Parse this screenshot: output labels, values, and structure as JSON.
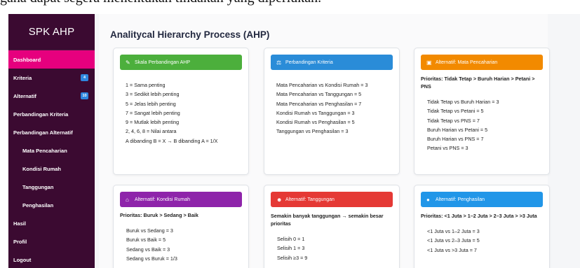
{
  "caption": "gana dapat segera menentukan tindakan yang diperlukan.",
  "brand": "SPK AHP",
  "sidebar": {
    "items": [
      {
        "label": "Dashboard",
        "badge": ""
      },
      {
        "label": "Kriteria",
        "badge": "4"
      },
      {
        "label": "Alternatif",
        "badge": "10"
      },
      {
        "label": "Perbandingan Kriteria",
        "badge": ""
      },
      {
        "label": "Perbandingan Alternatif",
        "badge": ""
      },
      {
        "label": "Mata Pencaharian",
        "badge": ""
      },
      {
        "label": "Kondisi Rumah",
        "badge": ""
      },
      {
        "label": "Tanggungan",
        "badge": ""
      },
      {
        "label": "Penghasilan",
        "badge": ""
      },
      {
        "label": "Hasil",
        "badge": ""
      },
      {
        "label": "Profil",
        "badge": ""
      },
      {
        "label": "Logout",
        "badge": ""
      }
    ]
  },
  "main": {
    "title": "Analitycal Hierarchy Process (AHP)",
    "cards": [
      {
        "title": "Skala Perbandingan AHP",
        "icon": "pencil-icon",
        "color": "#4caf3c",
        "priority": "",
        "lines": [
          "1 = Sama penting",
          "3 = Sedikit lebih penting",
          "5 = Jelas lebih penting",
          "7 = Sangat lebih penting",
          "9 = Mutlak lebih penting",
          "2, 4, 6, 8 = Nilai antara",
          "A dibanding B = X → B dibanding A = 1/X"
        ]
      },
      {
        "title": "Perbandingan Kriteria",
        "icon": "balance-icon",
        "color": "#2a8cd8",
        "priority": "",
        "lines": [
          "Mata Pencaharian vs Kondisi Rumah = 3",
          "Mata Pencaharian vs Tanggungan = 5",
          "Mata Pencaharian vs Penghasilan = 7",
          "Kondisi Rumah vs Tanggungan = 3",
          "Kondisi Rumah vs Penghasilan = 5",
          "Tanggungan vs Penghasilan = 3"
        ]
      },
      {
        "title": "Alternatif: Mata Pencaharian",
        "icon": "briefcase-icon",
        "color": "#f28a00",
        "priority": "Prioritas: Tidak Tetap > Buruh Harian > Petani > PNS",
        "lines": [
          "Tidak Tetap vs Buruh Harian = 3",
          "Tidak Tetap vs Petani = 5",
          "Tidak Tetap vs PNS = 7",
          "Buruh Harian vs Petani = 5",
          "Buruh Harian vs PNS = 7",
          "Petani vs PNS = 3"
        ]
      },
      {
        "title": "Alternatif: Kondisi Rumah",
        "icon": "house-icon",
        "color": "#8e24aa",
        "priority": "Prioritas: Buruk > Sedang > Baik",
        "lines": [
          "Buruk vs Sedang = 3",
          "Buruk vs Baik = 5",
          "Sedang vs Baik = 3",
          "Sedang vs Buruk = 1/3"
        ]
      },
      {
        "title": "Alternatif: Tanggungan",
        "icon": "family-icon",
        "color": "#e53935",
        "priority": "Semakin banyak tanggungan → semakin besar prioritas",
        "lines": [
          "Selisih 0 = 1",
          "Selisih 1 = 3",
          "Selisih ≥3 = 9"
        ]
      },
      {
        "title": "Alternatif: Penghasilan",
        "icon": "money-bag-icon",
        "color": "#2196e8",
        "priority": "Prioritas: <1 Juta > 1–2 Juta > 2–3 Juta > >3 Juta",
        "lines": [
          "<1 Juta vs 1–2 Juta = 3",
          "<1 Juta vs 2–3 Juta = 5",
          "<1 Juta vs >3 Juta = 7"
        ]
      }
    ]
  }
}
